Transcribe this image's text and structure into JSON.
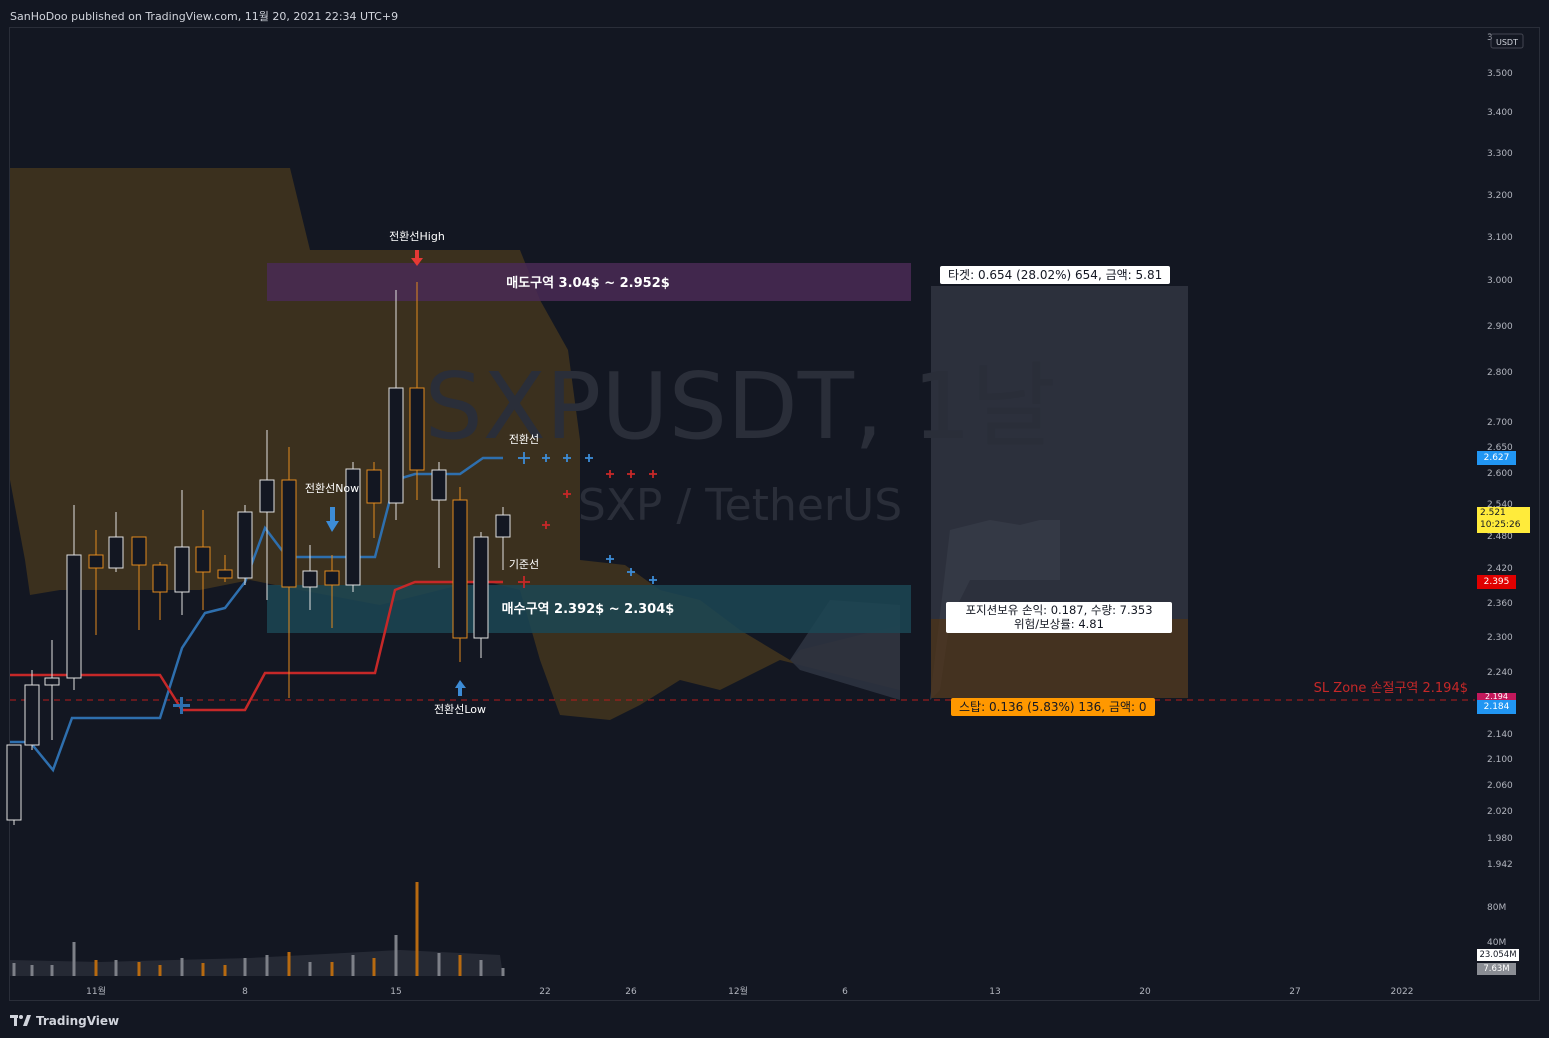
{
  "header": {
    "published": "SanHoDoo published on TradingView.com, 11월 20, 2021 22:34 UTC+9"
  },
  "watermark": {
    "symbol": "SXPUSDT, 1날",
    "pair": "SXP / TetherUS"
  },
  "price_axis": {
    "currency": "USDT",
    "ticks": [
      "3",
      "3.500",
      "3.400",
      "3.300",
      "3.200",
      "3.100",
      "3.000",
      "2.900",
      "2.800",
      "2.700",
      "2.650",
      "2.600",
      "2.540",
      "2.480",
      "2.420",
      "2.360",
      "2.300",
      "2.240",
      "2.140",
      "2.100",
      "2.060",
      "2.020",
      "1.980",
      "1.942",
      "80M",
      "40M"
    ],
    "badges": {
      "conversion": {
        "text": "2.627",
        "color": "#2196f3"
      },
      "last": {
        "text": "2.521",
        "time": "10:25:26",
        "color": "#ffeb3b"
      },
      "base": {
        "text": "2.395",
        "color": "#e00000"
      },
      "stop_hidden": {
        "text": "2.194",
        "color": "#c2185b"
      },
      "stop": {
        "text": "2.184",
        "color": "#2196f3"
      },
      "vol1": {
        "text": "23.054M"
      },
      "vol2": {
        "text": "7.63M"
      }
    }
  },
  "time_axis": {
    "labels": [
      "11월",
      "8",
      "15",
      "22",
      "26",
      "12월",
      "6",
      "13",
      "20",
      "27",
      "2022"
    ]
  },
  "annotations": {
    "sell_zone": "매도구역 3.04$ ~ 2.952$",
    "buy_zone": "매수구역 2.392$ ~ 2.304$",
    "conv_high": "전환선High",
    "conv_low": "전환선Low",
    "conv_now": "전환선Now",
    "conv_line": "전환선",
    "base_line": "기준선",
    "sl_zone": "SL Zone 손절구역 2.194$"
  },
  "position": {
    "target": "타겟: 0.654 (28.02%) 654, 금액: 5.81",
    "pnl_line1": "포지션보유 손익: 0.187, 수량: 7.353",
    "pnl_line2": "위험/보상률: 4.81",
    "stop": "스탑: 0.136 (5.83%) 136, 금액: 0"
  },
  "footer": {
    "brand": "TradingView"
  },
  "colors": {
    "bg": "#131722",
    "conversion": "#2962ff",
    "base": "#e00000",
    "cloud": "#4a3a22",
    "sell_zone": "#4a2a55",
    "buy_zone": "#1f4a5a"
  }
}
